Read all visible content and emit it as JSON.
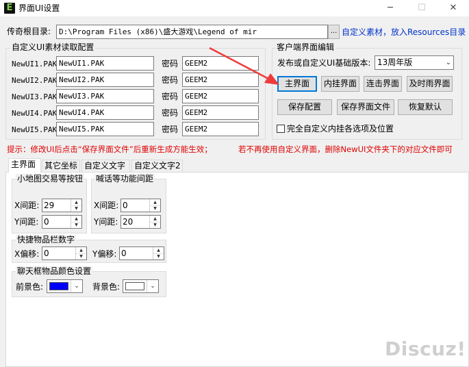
{
  "window": {
    "title": "界面UI设置",
    "icon_glyph": "E",
    "min_glyph": "─",
    "max_glyph": "☐",
    "close_glyph": "✕"
  },
  "root_dir": {
    "label": "传奇根目录:",
    "value": "D:\\Program Files (x86)\\盛大游戏\\Legend of mir",
    "browse_label": "...",
    "link_text": "自定义素材，放入Resources目录"
  },
  "custom_ui": {
    "group_title": "自定义UI素材读取配置",
    "password_label": "密码",
    "rows": [
      {
        "label": "NewUI1.PAK",
        "file": "NewUI1.PAK",
        "password": "GEEM2"
      },
      {
        "label": "NewUI2.PAK",
        "file": "NewUI2.PAK",
        "password": "GEEM2"
      },
      {
        "label": "NewUI3.PAK",
        "file": "NewUI3.PAK",
        "password": "GEEM2"
      },
      {
        "label": "NewUI4.PAK",
        "file": "NewUI4.PAK",
        "password": "GEEM2"
      },
      {
        "label": "NewUI5.PAK",
        "file": "NewUI5.PAK",
        "password": "GEEM2"
      }
    ]
  },
  "client_edit": {
    "group_title": "客户端界面编辑",
    "version_label": "发布或自定义UI基础版本:",
    "version_value": "13周年版",
    "buttons_row1": [
      "主界面",
      "内挂界面",
      "连击界面",
      "及时雨界面"
    ],
    "buttons_row2": [
      "保存配置",
      "保存界面文件",
      "恢复默认"
    ],
    "checkbox_label": "完全自定义内挂各选项及位置",
    "checkbox_checked": false
  },
  "tip": {
    "part1": "提示：修改UI后点击“保存界面文件”后重新生成方能生效；",
    "part2": "若不再使用自定义界面，删除NewUI文件夹下的对应文件即可"
  },
  "tabs": [
    "主界面",
    "其它坐标",
    "自定义文字",
    "自定义文字2"
  ],
  "active_tab": 0,
  "minimap_group": {
    "title": "小地图交易等按钮",
    "x_label": "X间距:",
    "x_value": "29",
    "y_label": "Y间距:",
    "y_value": "0"
  },
  "shout_group": {
    "title": "喊话等功能间距",
    "x_label": "X间距:",
    "x_value": "0",
    "y_label": "Y间距:",
    "y_value": "20"
  },
  "quickbar_group": {
    "title": "快捷物品栏数字",
    "x_label": "X偏移:",
    "x_value": "0",
    "y_label": "Y偏移:",
    "y_value": "0"
  },
  "chat_color_group": {
    "title": "聊天框物品颜色设置",
    "fg_label": "前景色:",
    "fg_color": "#0000ff",
    "bg_label": "背景色:",
    "bg_color": "#ffffff"
  },
  "watermark": "Discuz!",
  "annotation_arrow_color": "#ee3b3b"
}
